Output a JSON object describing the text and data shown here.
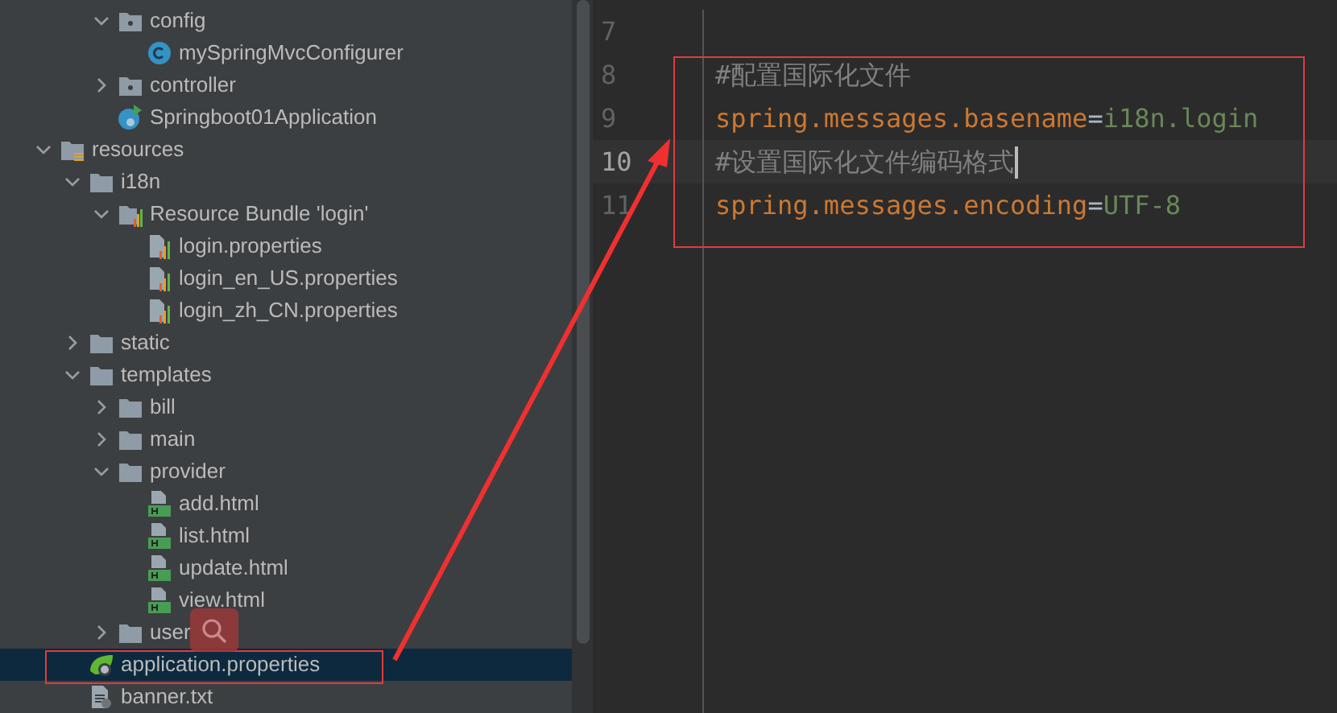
{
  "sidebar": {
    "package_items": [
      {
        "kind": "package",
        "label": "config",
        "expanded": true,
        "children": [
          {
            "kind": "class",
            "label": "mySpringMvcConfigurer"
          }
        ]
      },
      {
        "kind": "package",
        "label": "controller",
        "expanded": false
      },
      {
        "kind": "boot-class",
        "label": "Springboot01Application"
      }
    ],
    "items": [
      {
        "kind": "resources",
        "label": "resources",
        "expanded": true,
        "children": [
          {
            "kind": "folder",
            "label": "i18n",
            "expanded": true,
            "children": [
              {
                "kind": "bundle",
                "label": "Resource Bundle 'login'",
                "expanded": true,
                "children": [
                  {
                    "kind": "properties",
                    "label": "login.properties"
                  },
                  {
                    "kind": "properties",
                    "label": "login_en_US.properties"
                  },
                  {
                    "kind": "properties",
                    "label": "login_zh_CN.properties"
                  }
                ]
              }
            ]
          },
          {
            "kind": "folder",
            "label": "static",
            "expanded": false
          },
          {
            "kind": "folder",
            "label": "templates",
            "expanded": true,
            "children": [
              {
                "kind": "folder",
                "label": "bill",
                "expanded": false
              },
              {
                "kind": "folder",
                "label": "main",
                "expanded": false
              },
              {
                "kind": "folder",
                "label": "provider",
                "expanded": true,
                "children": [
                  {
                    "kind": "html",
                    "label": "add.html"
                  },
                  {
                    "kind": "html",
                    "label": "list.html"
                  },
                  {
                    "kind": "html",
                    "label": "update.html"
                  },
                  {
                    "kind": "html",
                    "label": "view.html"
                  }
                ]
              },
              {
                "kind": "folder",
                "label": "user",
                "expanded": false
              }
            ]
          },
          {
            "kind": "spring-properties",
            "label": "application.properties",
            "selected": true
          },
          {
            "kind": "text",
            "label": "banner.txt"
          }
        ]
      }
    ]
  },
  "editor": {
    "lines": [
      {
        "number": "7",
        "current": false
      },
      {
        "number": "8",
        "current": false,
        "segments": [
          {
            "kind": "comment",
            "text": "#配置国际化文件"
          }
        ]
      },
      {
        "number": "9",
        "current": false,
        "segments": [
          {
            "kind": "key",
            "text": "spring.messages.basename"
          },
          {
            "kind": "separator",
            "text": "="
          },
          {
            "kind": "value",
            "text": "i18n.login"
          }
        ]
      },
      {
        "number": "10",
        "current": true,
        "segments": [
          {
            "kind": "comment",
            "text": "#设置国际化文件编码格式"
          }
        ]
      },
      {
        "number": "11",
        "current": false,
        "segments": [
          {
            "kind": "key",
            "text": "spring.messages.encoding"
          },
          {
            "kind": "separator",
            "text": "="
          },
          {
            "kind": "value",
            "text": "UTF-8"
          }
        ]
      }
    ]
  }
}
